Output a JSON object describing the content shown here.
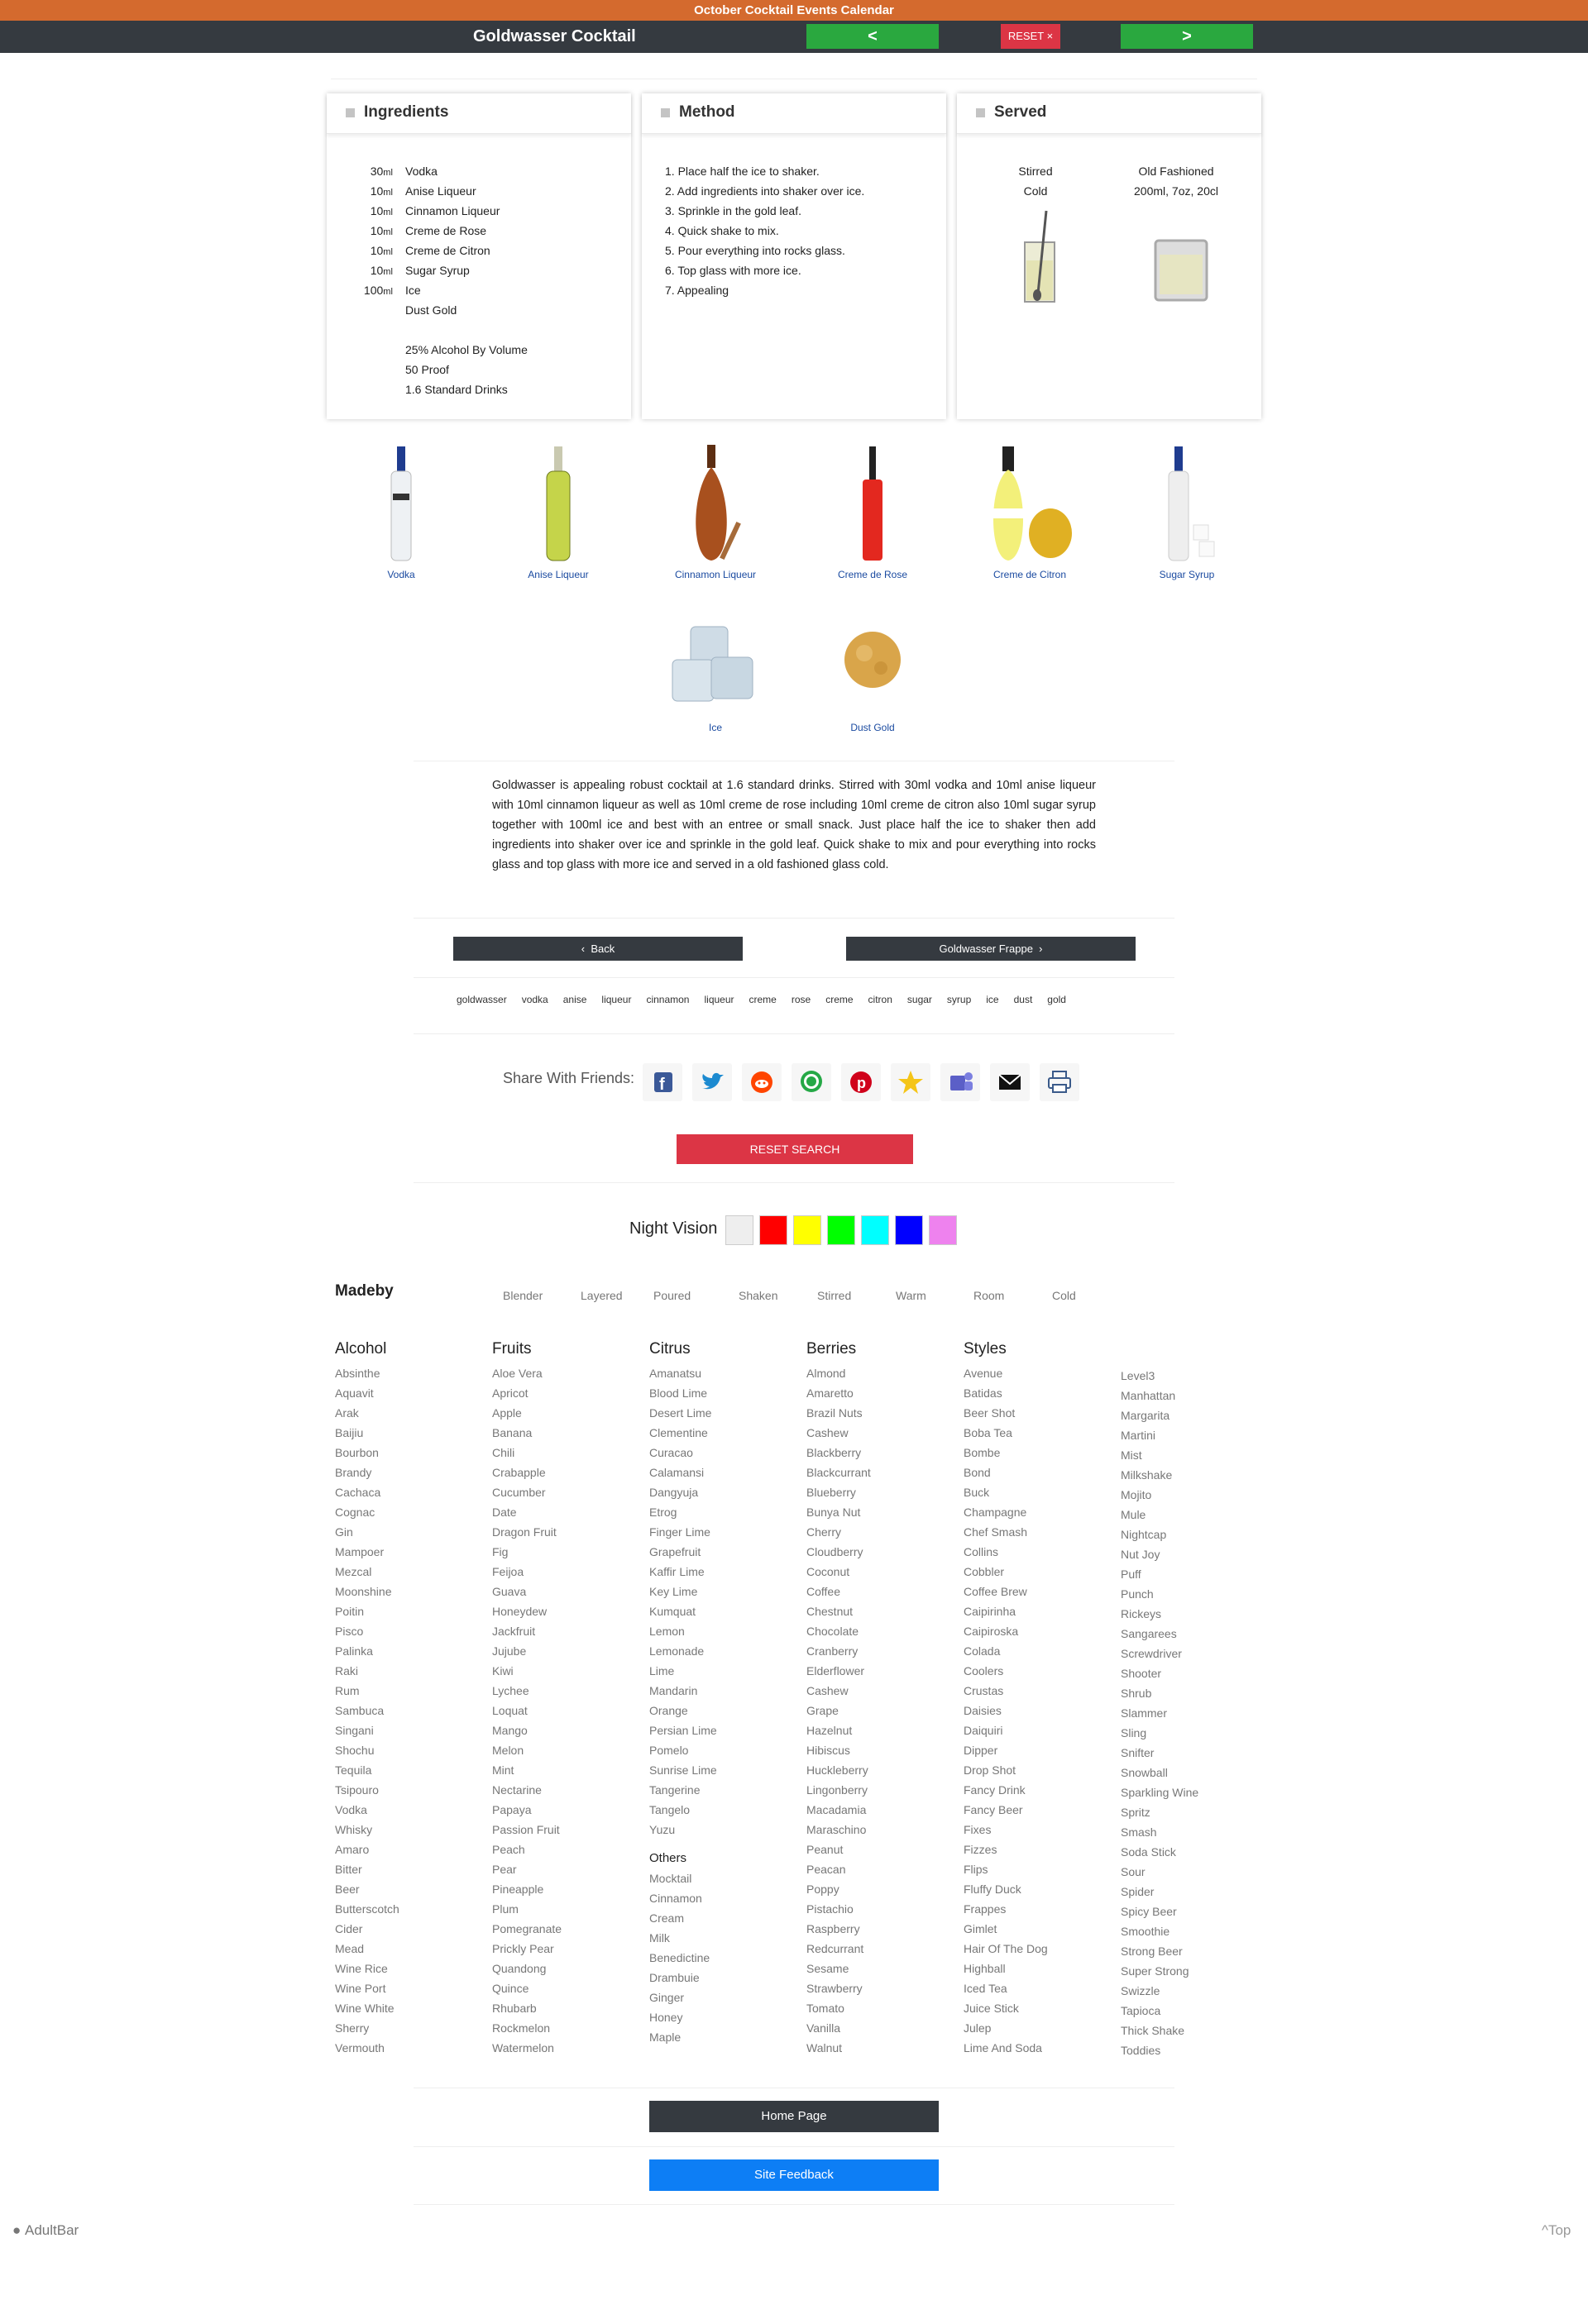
{
  "topbar": {
    "title": "October Cocktail Events Calendar"
  },
  "nav": {
    "title": "Goldwasser Cocktail",
    "prev": "<",
    "reset": "RESET ×",
    "next": ">"
  },
  "cards": {
    "ingredients": "Ingredients",
    "method": "Method",
    "served": "Served"
  },
  "ingredients": [
    {
      "amount": "30",
      "unit": "ml",
      "name": "Vodka"
    },
    {
      "amount": "10",
      "unit": "ml",
      "name": "Anise Liqueur"
    },
    {
      "amount": "10",
      "unit": "ml",
      "name": "Cinnamon Liqueur"
    },
    {
      "amount": "10",
      "unit": "ml",
      "name": "Creme de Rose"
    },
    {
      "amount": "10",
      "unit": "ml",
      "name": "Creme de Citron"
    },
    {
      "amount": "10",
      "unit": "ml",
      "name": "Sugar Syrup"
    },
    {
      "amount": "100",
      "unit": "ml",
      "name": "Ice"
    },
    {
      "amount": "",
      "unit": "",
      "name": "Dust Gold"
    }
  ],
  "stats": [
    "25% Alcohol By Volume",
    "50 Proof",
    "1.6 Standard Drinks"
  ],
  "method": [
    "1. Place half the ice to shaker.",
    "2. Add ingredients into shaker over ice.",
    "3. Sprinkle in the gold leaf.",
    "4. Quick shake to mix.",
    "5. Pour everything into rocks glass.",
    "6. Top glass with more ice.",
    "7. Appealing"
  ],
  "served": {
    "style": "Stirred",
    "temp": "Cold",
    "glass": "Old Fashioned",
    "size": "200ml, 7oz, 20cl"
  },
  "ingredient_images": [
    "Vodka",
    "Anise Liqueur",
    "Cinnamon Liqueur",
    "Creme de Rose",
    "Creme de Citron",
    "Sugar Syrup",
    "Ice",
    "Dust Gold"
  ],
  "description": "Goldwasser is appealing robust cocktail at 1.6 standard drinks. Stirred with 30ml vodka and 10ml anise liqueur with 10ml cinnamon liqueur as well as 10ml creme de rose including 10ml creme de citron also 10ml sugar syrup together with 100ml ice and best with an entree or small snack. Just place half the ice to shaker then add ingredients into shaker over ice and sprinkle in the gold leaf. Quick shake to mix and pour everything into rocks glass and top glass with more ice and served in a old fashioned glass cold.",
  "pager": {
    "back": "Back",
    "next": "Goldwasser Frappe"
  },
  "tags": [
    "goldwasser",
    "vodka",
    "anise",
    "liqueur",
    "cinnamon",
    "liqueur",
    "creme",
    "rose",
    "creme",
    "citron",
    "sugar",
    "syrup",
    "ice",
    "dust",
    "gold"
  ],
  "share": {
    "label": "Share With Friends:",
    "icons": [
      "facebook-icon",
      "twitter-icon",
      "reddit-icon",
      "whatsapp-icon",
      "pinterest-icon",
      "favorite-star-icon",
      "teams-icon",
      "email-icon",
      "print-icon"
    ]
  },
  "reset_search": "RESET SEARCH",
  "night_vision": {
    "label": "Night Vision",
    "colors": [
      "#eeeeee",
      "#ff0000",
      "#ffff00",
      "#00ff00",
      "#00ffff",
      "#0000ff",
      "#ee82ee"
    ]
  },
  "madeby": {
    "label": "Madeby",
    "items": [
      "Blender",
      "Layered",
      "Poured",
      "Shaken",
      "Stirred",
      "Warm",
      "Room",
      "Cold"
    ]
  },
  "categories": {
    "alcohol": {
      "title": "Alcohol",
      "items": [
        "Absinthe",
        "Aquavit",
        "Arak",
        "Baijiu",
        "Bourbon",
        "Brandy",
        "Cachaca",
        "Cognac",
        "Gin",
        "Mampoer",
        "Mezcal",
        "Moonshine",
        "Poitin",
        "Pisco",
        "Palinka",
        "Raki",
        "Rum",
        "Sambuca",
        "Singani",
        "Shochu",
        "Tequila",
        "Tsipouro",
        "Vodka",
        "Whisky",
        "Amaro",
        "Bitter",
        "Beer",
        "Butterscotch",
        "Cider",
        "Mead",
        "Wine Rice",
        "Wine Port",
        "Wine White",
        "Sherry",
        "Vermouth"
      ]
    },
    "fruits": {
      "title": "Fruits",
      "items": [
        "Aloe Vera",
        "Apricot",
        "Apple",
        "Banana",
        "Chili",
        "Crabapple",
        "Cucumber",
        "Date",
        "Dragon Fruit",
        "Fig",
        "Feijoa",
        "Guava",
        "Honeydew",
        "Jackfruit",
        "Jujube",
        "Kiwi",
        "Lychee",
        "Loquat",
        "Mango",
        "Melon",
        "Mint",
        "Nectarine",
        "Papaya",
        "Passion Fruit",
        "Peach",
        "Pear",
        "Pineapple",
        "Plum",
        "Pomegranate",
        "Prickly Pear",
        "Quandong",
        "Quince",
        "Rhubarb",
        "Rockmelon",
        "Watermelon"
      ]
    },
    "citrus": {
      "title": "Citrus",
      "items": [
        "Amanatsu",
        "Blood Lime",
        "Desert Lime",
        "Clementine",
        "Curacao",
        "Calamansi",
        "Dangyuja",
        "Etrog",
        "Finger Lime",
        "Grapefruit",
        "Kaffir Lime",
        "Key Lime",
        "Kumquat",
        "Lemon",
        "Lemonade",
        "Lime",
        "Mandarin",
        "Orange",
        "Persian Lime",
        "Pomelo",
        "Sunrise Lime",
        "Tangerine",
        "Tangelo",
        "Yuzu"
      ]
    },
    "others": {
      "title": "Others",
      "items": [
        "Mocktail",
        "Cinnamon",
        "Cream",
        "Milk",
        "Benedictine",
        "Drambuie",
        "Ginger",
        "Honey",
        "Maple"
      ]
    },
    "berries": {
      "title": "Berries",
      "items": [
        "Almond",
        "Amaretto",
        "Brazil Nuts",
        "Cashew",
        "Blackberry",
        "Blackcurrant",
        "Blueberry",
        "Bunya Nut",
        "Cherry",
        "Cloudberry",
        "Coconut",
        "Coffee",
        "Chestnut",
        "Chocolate",
        "Cranberry",
        "Elderflower",
        "Cashew",
        "Grape",
        "Hazelnut",
        "Hibiscus",
        "Huckleberry",
        "Lingonberry",
        "Macadamia",
        "Maraschino",
        "Peanut",
        "Peacan",
        "Poppy",
        "Pistachio",
        "Raspberry",
        "Redcurrant",
        "Sesame",
        "Strawberry",
        "Tomato",
        "Vanilla",
        "Walnut"
      ]
    },
    "styles": {
      "title": "Styles",
      "items": [
        "Avenue",
        "Batidas",
        "Beer Shot",
        "Boba Tea",
        "Bombe",
        "Bond",
        "Buck",
        "Champagne",
        "Chef Smash",
        "Collins",
        "Cobbler",
        "Coffee Brew",
        "Caipirinha",
        "Caipiroska",
        "Colada",
        "Coolers",
        "Crustas",
        "Daisies",
        "Daiquiri",
        "Dipper",
        "Drop Shot",
        "Fancy Drink",
        "Fancy Beer",
        "Fixes",
        "Fizzes",
        "Flips",
        "Fluffy Duck",
        "Frappes",
        "Gimlet",
        "Hair Of The Dog",
        "Highball",
        "Iced Tea",
        "Juice Stick",
        "Julep",
        "Lime And Soda"
      ]
    },
    "styles2": {
      "items": [
        "Level3",
        "Manhattan",
        "Margarita",
        "Martini",
        "Mist",
        "Milkshake",
        "Mojito",
        "Mule",
        "Nightcap",
        "Nut Joy",
        "Puff",
        "Punch",
        "Rickeys",
        "Sangarees",
        "Screwdriver",
        "Shooter",
        "Shrub",
        "Slammer",
        "Sling",
        "Snifter",
        "Snowball",
        "Sparkling Wine",
        "Spritz",
        "Smash",
        "Soda Stick",
        "Sour",
        "Spider",
        "Spicy Beer",
        "Smoothie",
        "Strong Beer",
        "Super Strong",
        "Swizzle",
        "Tapioca",
        "Thick Shake",
        "Toddies"
      ]
    }
  },
  "footer": {
    "home": "Home Page",
    "feedback": "Site Feedback",
    "brand": "AdultBar",
    "top": "^Top"
  }
}
